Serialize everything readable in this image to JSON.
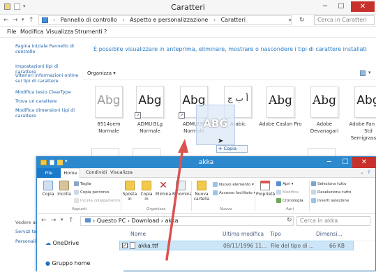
{
  "fonts_window": {
    "title": "Caratteri",
    "address": {
      "crumbs": [
        "Pannello di controllo",
        "Aspetto e personalizzazione",
        "Caratteri"
      ],
      "search_placeholder": "Cerca in Caratteri"
    },
    "menu": [
      "File",
      "Modifica",
      "Visualizza",
      "Strumenti",
      "?"
    ],
    "sidebar": {
      "home_link": "Pagina iniziale Pannello di controllo",
      "links": [
        "Impostazioni tipi di carattere",
        "Ulteriori informazioni online sui tipi di carattere",
        "Modifica testo ClearType",
        "Trova un carattere",
        "Modifica dimensioni tipi di carattere"
      ],
      "see_also_label": "Vedere an",
      "see_also_items": [
        "Servizi tes",
        "Personaliz"
      ]
    },
    "heading": "È possibile visualizzare in anteprima, eliminare, mostrare o nascondere i tipi di carattere installati",
    "toolbar": {
      "organize": "Organizza"
    },
    "fonts": [
      {
        "glyph": "Abg",
        "name": "8514oem Normale",
        "faded": true,
        "shortcut": false,
        "serif": false
      },
      {
        "glyph": "Abg",
        "name": "ADMUI3Lg Normale",
        "faded": false,
        "shortcut": true,
        "serif": false
      },
      {
        "glyph": "Abg",
        "name": "ADMUI3S Normale",
        "faded": false,
        "shortcut": true,
        "serif": false
      },
      {
        "glyph": "أ ب ج",
        "name": "Arabic",
        "faded": false,
        "shortcut": false,
        "serif": false
      },
      {
        "glyph": "Abg",
        "name": "Adobe Caslon Pro",
        "faded": false,
        "shortcut": false,
        "serif": true
      },
      {
        "glyph": "Abg",
        "name": "Adobe Devanagari",
        "faded": false,
        "shortcut": false,
        "serif": true
      },
      {
        "glyph": "Abg",
        "name": "Adobe Fan Heiti Std Semigrassetto",
        "faded": false,
        "shortcut": false,
        "serif": false
      }
    ],
    "drag": {
      "ghost_glyph": "ABG",
      "tooltip": "Copia"
    }
  },
  "explorer_window": {
    "title": "akka",
    "tabs": [
      "File",
      "Home",
      "Condividi",
      "Visualizza"
    ],
    "ribbon": {
      "copia": "Copia",
      "incolla": "Incolla",
      "taglia": "Taglia",
      "copia_percorso": "Copia percorso",
      "incolla_collegamento": "Incolla collegamento",
      "sposta_in": "Sposta in",
      "copia_in": "Copia in",
      "elimina": "Elimina",
      "rinomina": "Rinomina",
      "nuova_cartella": "Nuova cartella",
      "nuovo_elemento": "Nuovo elemento",
      "accesso_facilitato": "Accesso facilitato",
      "proprieta": "Proprietà",
      "apri": "Apri",
      "modifica": "Modifica",
      "cronologia": "Cronologia",
      "seleziona_tutto": "Seleziona tutto",
      "deseleziona_tutto": "Deseleziona tutto",
      "inverti_selezione": "Inverti selezione",
      "groups": [
        "Appunti",
        "Organizza",
        "Nuovo",
        "Apri"
      ]
    },
    "address": {
      "crumbs": [
        "Questo PC",
        "Download",
        "akka"
      ],
      "search_placeholder": "Cerca in akka"
    },
    "nav": [
      "OneDrive",
      "Gruppo home"
    ],
    "columns": [
      "Nome",
      "Ultima modifica",
      "Tipo",
      "Dimensi..."
    ],
    "rows": [
      {
        "name": "akka.ttf",
        "modified": "08/11/1996 11...",
        "type": "File del tipo di ...",
        "size": "66 KB"
      }
    ]
  },
  "colors": {
    "link_blue": "#1b5fa8",
    "heading_blue": "#2a7cc7",
    "explorer_frame": "#2d89ce",
    "close_red": "#c7302b",
    "arrow_red": "#d9534f",
    "selection": "#cde6f7"
  }
}
